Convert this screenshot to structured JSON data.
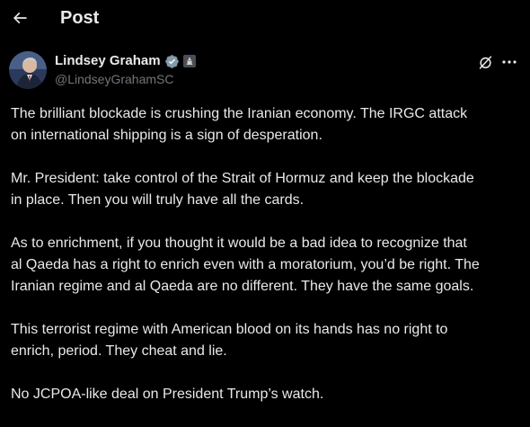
{
  "header": {
    "title": "Post",
    "back_icon": "arrow-left-icon"
  },
  "author": {
    "display_name": "Lindsey Graham",
    "handle": "@LindseyGrahamSC",
    "verified_icon": "verified-badge-icon",
    "affiliation_icon": "government-affiliation-icon",
    "verified_color": "#829aab"
  },
  "actions": {
    "grok_icon": "grok-icon",
    "more_icon": "more-options-icon"
  },
  "tweet": {
    "paragraphs": [
      "The brilliant blockade is crushing the Iranian economy. The IRGC attack\non international shipping is a sign of desperation.",
      "Mr. President: take control of the Strait of Hormuz and keep the blockade\nin place. Then you will truly have all the cards.",
      "As to enrichment, if you thought it would be a bad idea to recognize that\nal Qaeda has a right to enrich even with a moratorium, you’d be right. The\nIranian regime and al Qaeda are no different. They have the same goals.",
      "This terrorist regime with American blood on its hands has no right to\nenrich, period. They cheat and lie.",
      "No JCPOA-like deal on President Trump’s watch."
    ]
  },
  "colors": {
    "background": "#000000",
    "text_primary": "#e7e9ea",
    "text_secondary": "#71767b"
  }
}
